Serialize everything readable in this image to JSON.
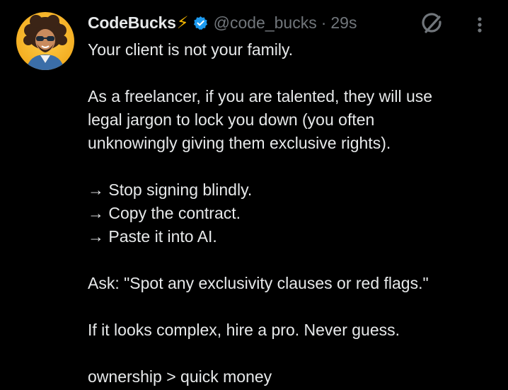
{
  "author": {
    "display_name": "CodeBucks",
    "emoji": "⚡",
    "handle": "@code_bucks",
    "separator": "·",
    "time": "29s",
    "verified_color": "#1d9bf0",
    "avatar_icon": "avatar-image"
  },
  "icons": {
    "grok": "grok-icon",
    "more": "more-vertical-icon"
  },
  "tweet": {
    "line1": "Your client is not your family.",
    "para2_line1": "As a freelancer, if you are talented, they will use",
    "para2_line2": "legal jargon to lock you down (you often",
    "para2_line3": "unknowingly giving them exclusive rights).",
    "step1": "→ Stop signing blindly.",
    "step2": "→ Copy the contract.",
    "step3": "→ Paste it into AI.",
    "ask": "Ask: \"Spot any exclusivity clauses or red flags.\"",
    "advice": "If it looks complex, hire a pro. Never guess.",
    "closing": "ownership > quick money"
  },
  "colors": {
    "background": "#000000",
    "primary_text": "#e7e9ea",
    "secondary_text": "#71767b",
    "accent": "#1d9bf0",
    "bolt": "#f5b700"
  }
}
